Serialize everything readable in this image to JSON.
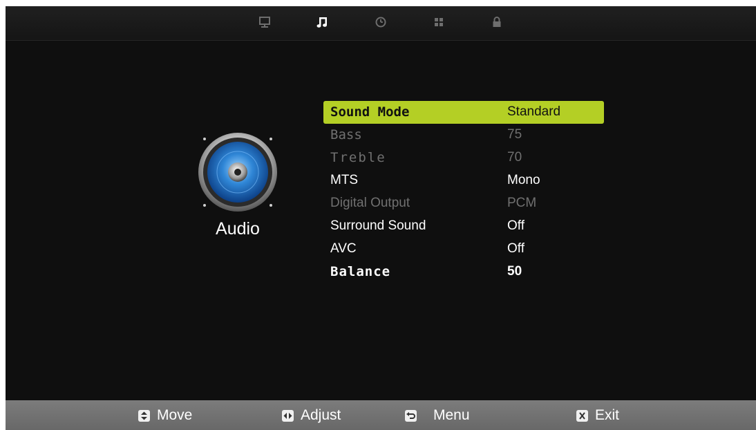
{
  "tabs": [
    {
      "icon": "monitor-icon",
      "active": false
    },
    {
      "icon": "music-note-icon",
      "active": true
    },
    {
      "icon": "clock-icon",
      "active": false
    },
    {
      "icon": "apps-grid-icon",
      "active": false
    },
    {
      "icon": "lock-icon",
      "active": false
    }
  ],
  "section": {
    "title": "Audio",
    "icon": "speaker-icon"
  },
  "menu": {
    "sound_mode": {
      "label": "Sound Mode",
      "value": "Standard"
    },
    "bass": {
      "label": "Bass",
      "value": "75"
    },
    "treble": {
      "label": "Treble",
      "value": "70"
    },
    "mts": {
      "label": "MTS",
      "value": "Mono"
    },
    "digital_output": {
      "label": "Digital Output",
      "value": "PCM"
    },
    "surround_sound": {
      "label": "Surround Sound",
      "value": "Off"
    },
    "avc": {
      "label": "AVC",
      "value": "Off"
    },
    "balance": {
      "label": "Balance",
      "value": "50"
    }
  },
  "footer": {
    "move": {
      "label": "Move",
      "icon": "up-down-arrows-icon"
    },
    "adjust": {
      "label": "Adjust",
      "icon": "left-right-arrows-icon"
    },
    "menu": {
      "label": "Menu",
      "icon": "return-arrow-icon"
    },
    "exit": {
      "label": "Exit",
      "icon": "exit-x-icon"
    }
  },
  "colors": {
    "background": "#0f0f0f",
    "highlight": "#b4cf25",
    "active_tab": "#ffffff",
    "inactive_tab": "#6e6e6e",
    "disabled_text": "#707070",
    "footer": "#747474"
  }
}
